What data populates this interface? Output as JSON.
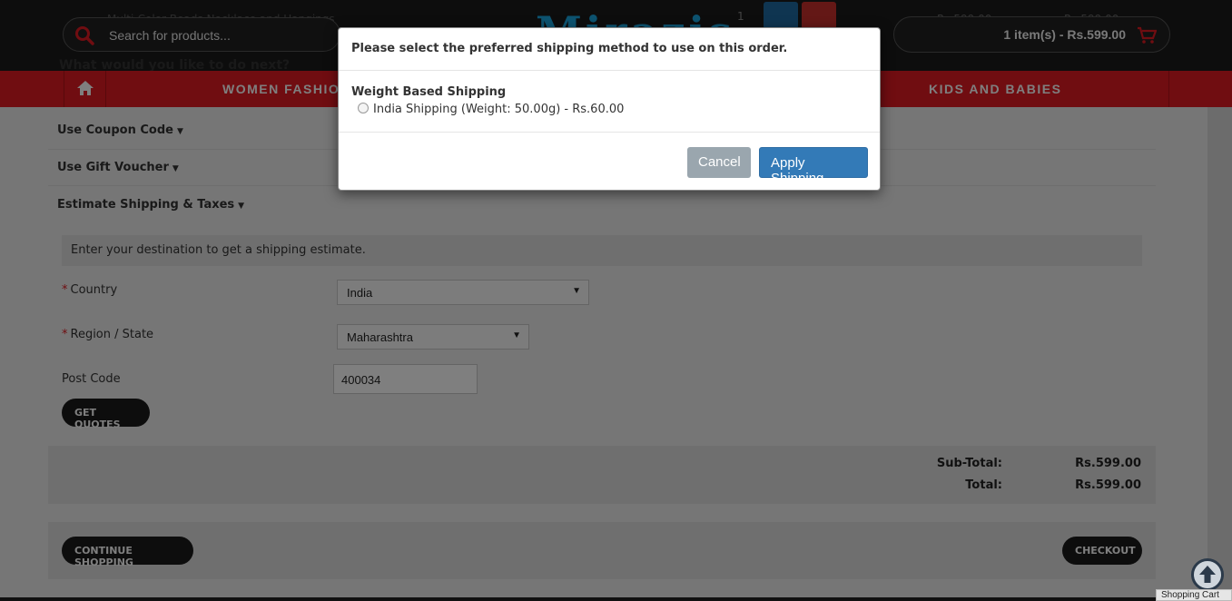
{
  "header": {
    "search_placeholder": "Search for products...",
    "cart_summary": "1 item(s) - Rs.599.00",
    "product_name_peek": "Multi-Color Beads Necklace and Hangings",
    "price_peek_1": "Rs.599.00",
    "price_peek_2": "Rs.599.00",
    "qty_peek": "1",
    "logo_peek": "Mirazis"
  },
  "nav": {
    "items": [
      {
        "label": "WOMEN FASHION"
      },
      {
        "label": "KIDS AND BABIES"
      }
    ]
  },
  "page": {
    "next_heading": "What would you like to do next?",
    "coupon": "Use Coupon Code",
    "voucher": "Use Gift Voucher",
    "estimate": "Estimate Shipping & Taxes",
    "notice": "Enter your destination to get a shipping estimate.",
    "country_label": "Country",
    "country_value": "India",
    "region_label": "Region / State",
    "region_value": "Maharashtra",
    "postcode_label": "Post Code",
    "postcode_value": "400034",
    "get_quotes": "GET QUOTES",
    "subtotal_label": "Sub-Total:",
    "subtotal_value": "Rs.599.00",
    "total_label": "Total:",
    "total_value": "Rs.599.00",
    "continue": "CONTINUE SHOPPING",
    "checkout": "CHECKOUT"
  },
  "modal": {
    "title": "Please select the preferred shipping method to use on this order.",
    "group": "Weight Based Shipping",
    "option": "India Shipping (Weight: 50.00g) - Rs.60.00",
    "cancel": "Cancel",
    "apply": "Apply Shipping"
  },
  "status_bar": "Shopping Cart",
  "colors": {
    "nav_red": "#e01a22",
    "primary_blue": "#337ab7",
    "header_dark": "#1b1b1b"
  }
}
